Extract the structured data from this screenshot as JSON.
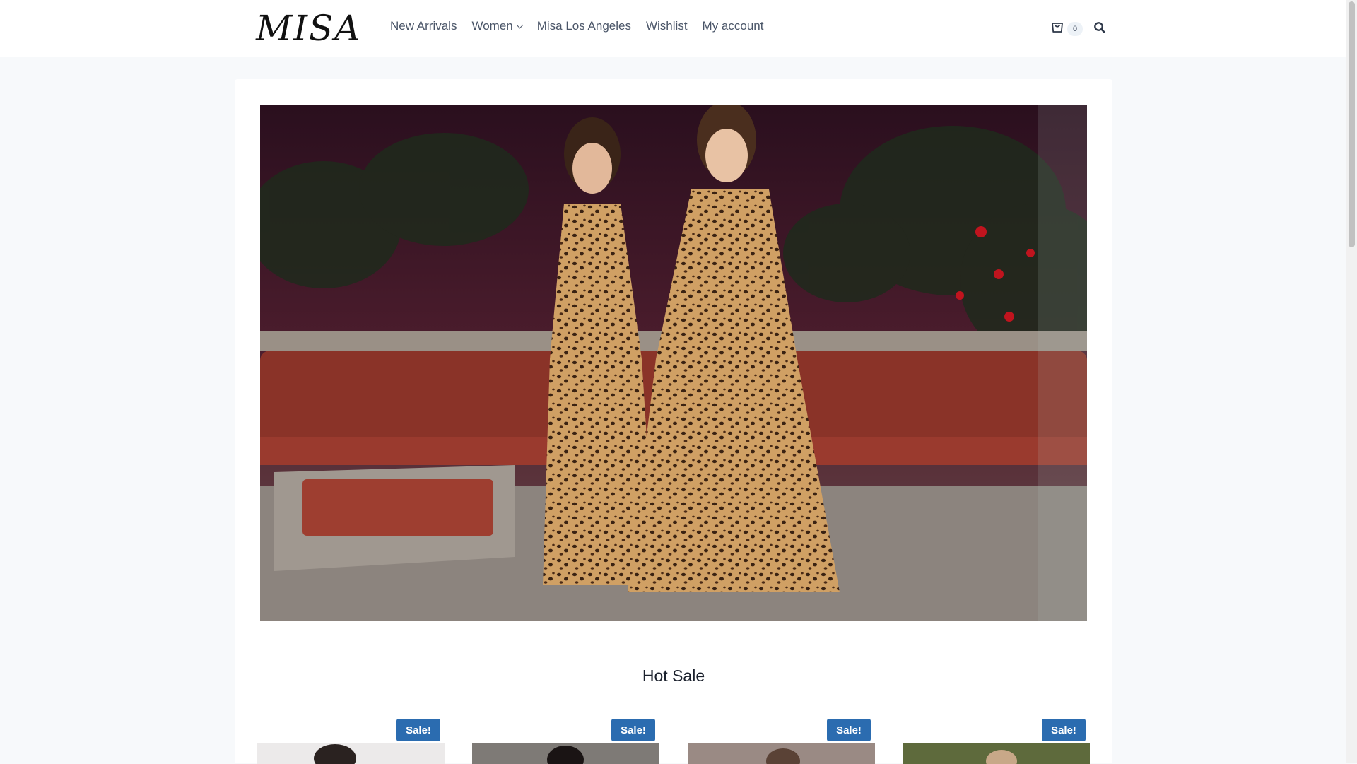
{
  "brand": {
    "logo_text": "MISA"
  },
  "nav": {
    "items": [
      {
        "label": "New Arrivals"
      },
      {
        "label": "Women"
      },
      {
        "label": "Misa Los Angeles"
      },
      {
        "label": "Wishlist"
      },
      {
        "label": "My account"
      }
    ]
  },
  "cart": {
    "count": "0",
    "icon": "shopping-bag-icon"
  },
  "search": {
    "icon": "search-icon"
  },
  "hero": {
    "description_icon": "hero-image"
  },
  "section": {
    "title": "Hot Sale"
  },
  "products": [
    {
      "badge": "Sale!"
    },
    {
      "badge": "Sale!"
    },
    {
      "badge": "Sale!"
    },
    {
      "badge": "Sale!"
    }
  ],
  "colors": {
    "accent": "#2b6cb0",
    "text": "#4a5568",
    "background": "#f7f9fb"
  }
}
